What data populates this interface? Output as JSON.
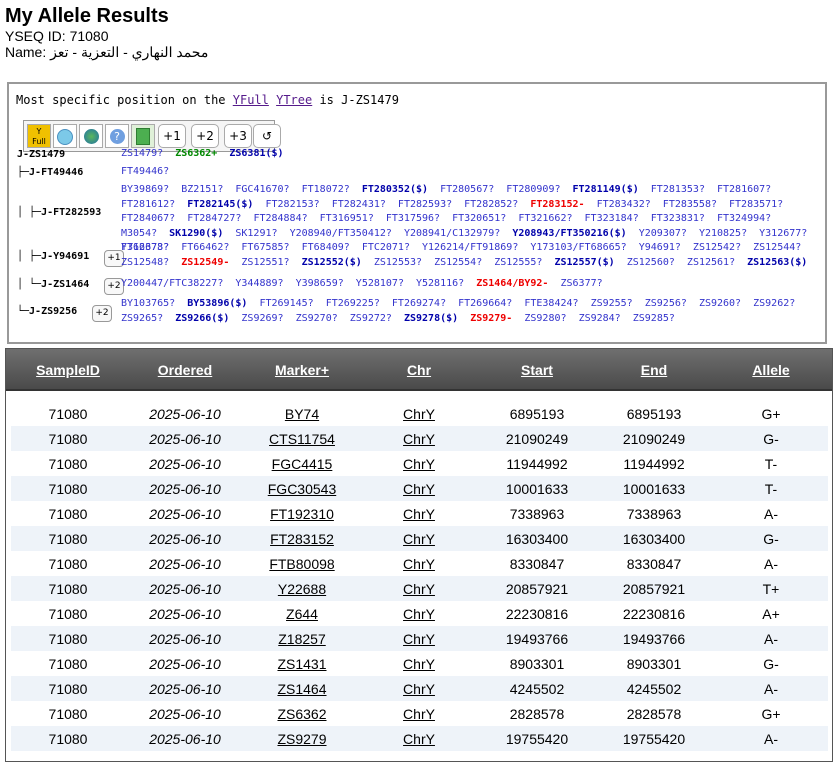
{
  "page": {
    "title": "My Allele Results",
    "yseq_id": "YSEQ ID: 71080",
    "name": "Name: محمد النهاري - التعزية - تعز"
  },
  "tree": {
    "prefix": "Most specific position on the ",
    "link1": "YFull",
    "link2": "YTree",
    "suffix": " is J-ZS1479",
    "toolbar": {
      "full_icon": "yfull-icon",
      "b1": "+1",
      "b2": "+2",
      "b3": "+3",
      "b4": "↺"
    },
    "rows": [
      {
        "label": "J-ZS1479",
        "btn": "",
        "snps": [
          {
            "t": "ZS1479?",
            "c": "plain"
          },
          {
            "t": "ZS6362+",
            "c": "grn"
          },
          {
            "t": "ZS6381($)",
            "c": "pos"
          }
        ]
      },
      {
        "label": "├─J-FT49446",
        "btn": "",
        "snps": [
          {
            "t": "FT49446?",
            "c": "plain"
          }
        ]
      },
      {
        "label": "│ ├─J-FT282593",
        "btn": "",
        "snps": [
          {
            "t": "BY39869?",
            "c": "plain"
          },
          {
            "t": "BZ2151?",
            "c": "plain"
          },
          {
            "t": "FGC41670?",
            "c": "plain"
          },
          {
            "t": "FT18072?",
            "c": "plain"
          },
          {
            "t": "FT280352($)",
            "c": "pos"
          },
          {
            "t": "FT280567?",
            "c": "plain"
          },
          {
            "t": "FT280909?",
            "c": "plain"
          },
          {
            "t": "FT281149($)",
            "c": "pos"
          },
          {
            "t": "FT281353?",
            "c": "plain"
          },
          {
            "t": "FT281607?",
            "c": "plain"
          },
          {
            "t": "FT281612?",
            "c": "plain"
          },
          {
            "t": "FT282145($)",
            "c": "pos"
          },
          {
            "t": "FT282153?",
            "c": "plain"
          },
          {
            "t": "FT282431?",
            "c": "plain"
          },
          {
            "t": "FT282593?",
            "c": "plain"
          },
          {
            "t": "FT282852?",
            "c": "plain"
          },
          {
            "t": "FT283152-",
            "c": "neg"
          },
          {
            "t": "FT283432?",
            "c": "plain"
          },
          {
            "t": "FT283558?",
            "c": "plain"
          },
          {
            "t": "FT283571?",
            "c": "plain"
          },
          {
            "t": "FT284067?",
            "c": "plain"
          },
          {
            "t": "FT284727?",
            "c": "plain"
          },
          {
            "t": "FT284884?",
            "c": "plain"
          },
          {
            "t": "FT316951?",
            "c": "plain"
          },
          {
            "t": "FT317596?",
            "c": "plain"
          },
          {
            "t": "FT320651?",
            "c": "plain"
          },
          {
            "t": "FT321662?",
            "c": "plain"
          },
          {
            "t": "FT323184?",
            "c": "plain"
          },
          {
            "t": "FT323831?",
            "c": "plain"
          },
          {
            "t": "FT324994?",
            "c": "plain"
          },
          {
            "t": "M3054?",
            "c": "plain"
          },
          {
            "t": "SK1290($)",
            "c": "pos"
          },
          {
            "t": "SK1291?",
            "c": "plain"
          },
          {
            "t": "Y208940/FT350412?",
            "c": "plain"
          },
          {
            "t": "Y208941/C132979?",
            "c": "plain"
          },
          {
            "t": "Y208943/FT350216($)",
            "c": "pos"
          },
          {
            "t": "Y209307?",
            "c": "plain"
          },
          {
            "t": "Y210825?",
            "c": "plain"
          },
          {
            "t": "Y312677?",
            "c": "plain"
          },
          {
            "t": "Y312678?",
            "c": "plain"
          }
        ]
      },
      {
        "label": "│ ├─J-Y94691",
        "btn": "+1",
        "snps": [
          {
            "t": "FT66373?",
            "c": "plain"
          },
          {
            "t": "FT66462?",
            "c": "plain"
          },
          {
            "t": "FT67585?",
            "c": "plain"
          },
          {
            "t": "FT68409?",
            "c": "plain"
          },
          {
            "t": "FTC2071?",
            "c": "plain"
          },
          {
            "t": "Y126214/FT91869?",
            "c": "plain"
          },
          {
            "t": "Y173103/FT68665?",
            "c": "plain"
          },
          {
            "t": "Y94691?",
            "c": "plain"
          },
          {
            "t": "ZS12542?",
            "c": "plain"
          },
          {
            "t": "ZS12544?",
            "c": "plain"
          },
          {
            "t": "ZS12548?",
            "c": "plain"
          },
          {
            "t": "ZS12549-",
            "c": "neg"
          },
          {
            "t": "ZS12551?",
            "c": "plain"
          },
          {
            "t": "ZS12552($)",
            "c": "pos"
          },
          {
            "t": "ZS12553?",
            "c": "plain"
          },
          {
            "t": "ZS12554?",
            "c": "plain"
          },
          {
            "t": "ZS12555?",
            "c": "plain"
          },
          {
            "t": "ZS12557($)",
            "c": "pos"
          },
          {
            "t": "ZS12560?",
            "c": "plain"
          },
          {
            "t": "ZS12561?",
            "c": "plain"
          },
          {
            "t": "ZS12563($)",
            "c": "pos"
          }
        ]
      },
      {
        "label": "│ └─J-ZS1464",
        "btn": "+2",
        "snps": [
          {
            "t": "Y200447/FTC38227?",
            "c": "plain"
          },
          {
            "t": "Y344889?",
            "c": "plain"
          },
          {
            "t": "Y398659?",
            "c": "plain"
          },
          {
            "t": "Y528107?",
            "c": "plain"
          },
          {
            "t": "Y528116?",
            "c": "plain"
          },
          {
            "t": "ZS1464/BY92-",
            "c": "neg"
          },
          {
            "t": "ZS6377?",
            "c": "plain"
          }
        ]
      },
      {
        "label": "└─J-ZS9256",
        "btn": "+2",
        "snps": [
          {
            "t": "BY103765?",
            "c": "plain"
          },
          {
            "t": "BY53896($)",
            "c": "pos"
          },
          {
            "t": "FT269145?",
            "c": "plain"
          },
          {
            "t": "FT269225?",
            "c": "plain"
          },
          {
            "t": "FT269274?",
            "c": "plain"
          },
          {
            "t": "FT269664?",
            "c": "plain"
          },
          {
            "t": "FTE38424?",
            "c": "plain"
          },
          {
            "t": "ZS9255?",
            "c": "plain"
          },
          {
            "t": "ZS9256?",
            "c": "plain"
          },
          {
            "t": "ZS9260?",
            "c": "plain"
          },
          {
            "t": "ZS9262?",
            "c": "plain"
          },
          {
            "t": "ZS9265?",
            "c": "plain"
          },
          {
            "t": "ZS9266($)",
            "c": "pos"
          },
          {
            "t": "ZS9269?",
            "c": "plain"
          },
          {
            "t": "ZS9270?",
            "c": "plain"
          },
          {
            "t": "ZS9272?",
            "c": "plain"
          },
          {
            "t": "ZS9278($)",
            "c": "pos"
          },
          {
            "t": "ZS9279-",
            "c": "neg"
          },
          {
            "t": "ZS9280?",
            "c": "plain"
          },
          {
            "t": "ZS9284?",
            "c": "plain"
          },
          {
            "t": "ZS9285?",
            "c": "plain"
          }
        ]
      }
    ]
  },
  "table": {
    "headers": [
      "SampleID",
      "Ordered",
      "Marker+",
      "Chr",
      "Start",
      "End",
      "Allele"
    ],
    "rows": [
      [
        "71080",
        "2025-06-10",
        "BY74",
        "ChrY",
        "6895193",
        "6895193",
        "G+"
      ],
      [
        "71080",
        "2025-06-10",
        "CTS11754",
        "ChrY",
        "21090249",
        "21090249",
        "G-"
      ],
      [
        "71080",
        "2025-06-10",
        "FGC4415",
        "ChrY",
        "11944992",
        "11944992",
        "T-"
      ],
      [
        "71080",
        "2025-06-10",
        "FGC30543",
        "ChrY",
        "10001633",
        "10001633",
        "T-"
      ],
      [
        "71080",
        "2025-06-10",
        "FT192310",
        "ChrY",
        "7338963",
        "7338963",
        "A-"
      ],
      [
        "71080",
        "2025-06-10",
        "FT283152",
        "ChrY",
        "16303400",
        "16303400",
        "G-"
      ],
      [
        "71080",
        "2025-06-10",
        "FTB80098",
        "ChrY",
        "8330847",
        "8330847",
        "A-"
      ],
      [
        "71080",
        "2025-06-10",
        "Y22688",
        "ChrY",
        "20857921",
        "20857921",
        "T+"
      ],
      [
        "71080",
        "2025-06-10",
        "Z644",
        "ChrY",
        "22230816",
        "22230816",
        "A+"
      ],
      [
        "71080",
        "2025-06-10",
        "Z18257",
        "ChrY",
        "19493766",
        "19493766",
        "A-"
      ],
      [
        "71080",
        "2025-06-10",
        "ZS1431",
        "ChrY",
        "8903301",
        "8903301",
        "G-"
      ],
      [
        "71080",
        "2025-06-10",
        "ZS1464",
        "ChrY",
        "4245502",
        "4245502",
        "A-"
      ],
      [
        "71080",
        "2025-06-10",
        "ZS6362",
        "ChrY",
        "2828578",
        "2828578",
        "G+"
      ],
      [
        "71080",
        "2025-06-10",
        "ZS9279",
        "ChrY",
        "19755420",
        "19755420",
        "A-"
      ]
    ]
  }
}
